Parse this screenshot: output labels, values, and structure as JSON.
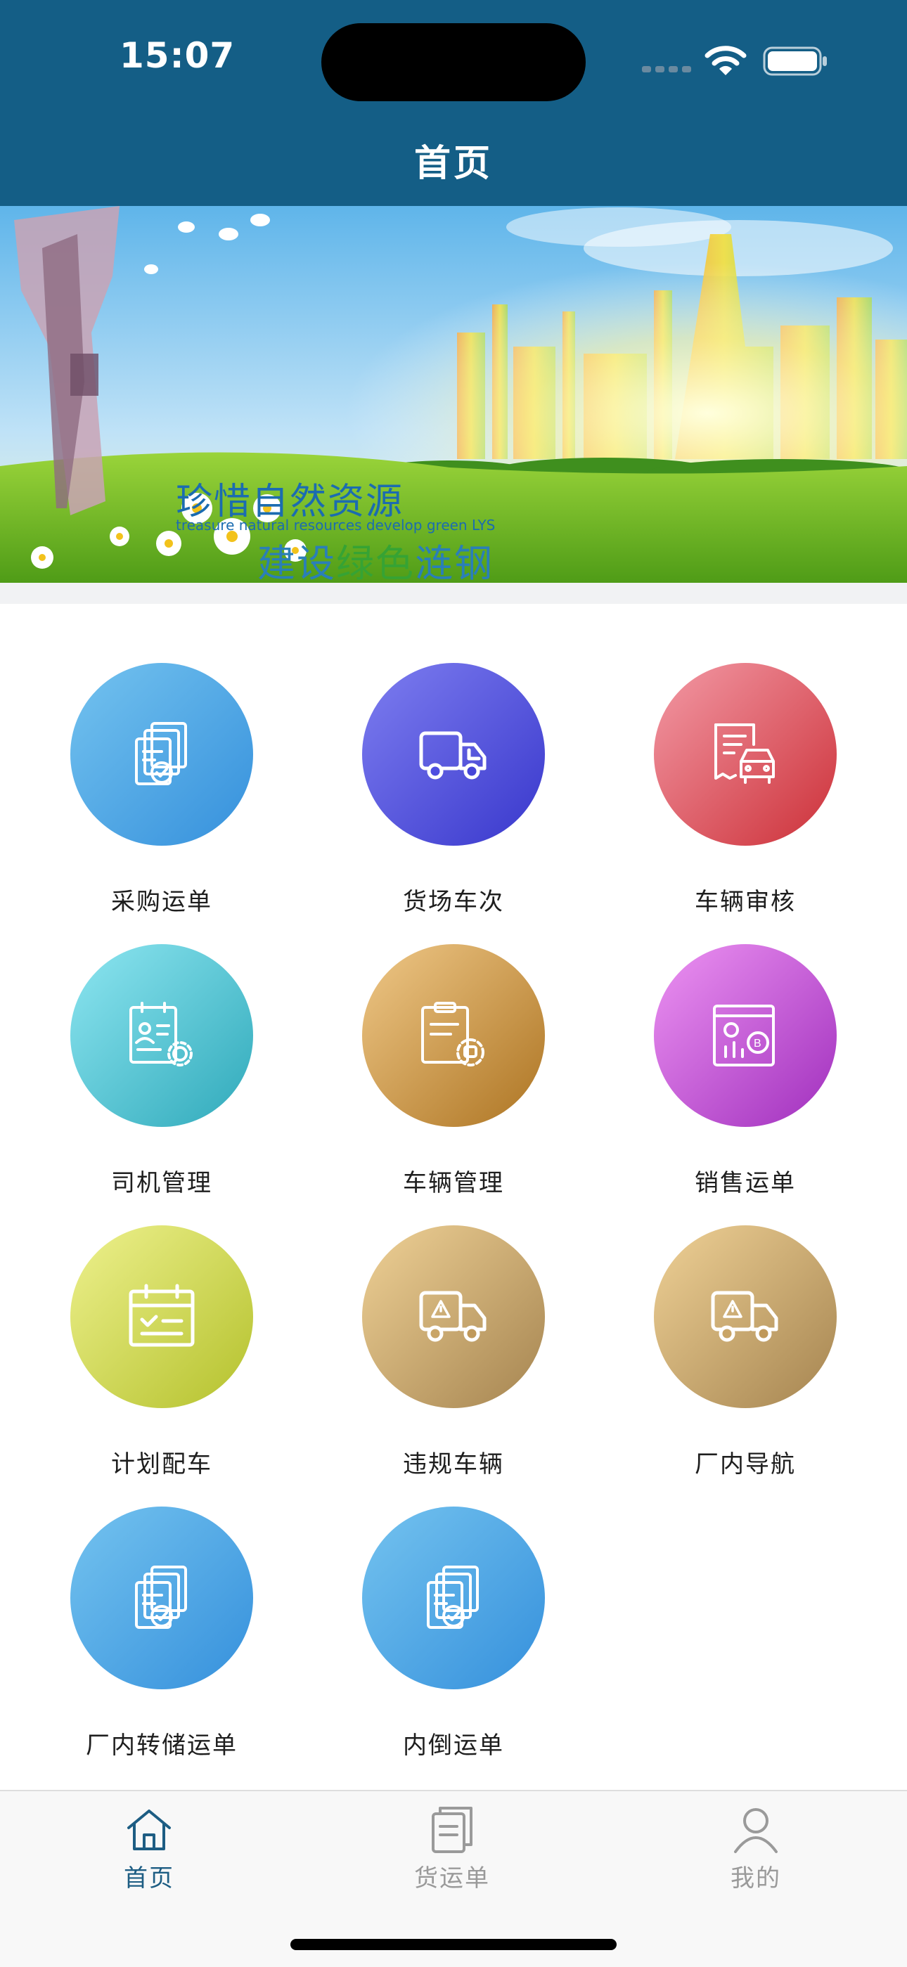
{
  "status_bar": {
    "time": "15:07"
  },
  "header": {
    "title": "首页",
    "background_color": "#145e86"
  },
  "banner": {
    "title": "珍惜自然资源",
    "subtitle": "treasure natural resources develop green LYS",
    "slogan_part1": "建设",
    "slogan_part2": "绿色",
    "slogan_part3": "涟钢"
  },
  "menu": {
    "items": [
      {
        "label": "采购运单",
        "icon": "documents-check-icon",
        "color": "blue"
      },
      {
        "label": "货场车次",
        "icon": "truck-icon",
        "color": "indigo"
      },
      {
        "label": "车辆审核",
        "icon": "document-car-icon",
        "color": "red"
      },
      {
        "label": "司机管理",
        "icon": "clipboard-person-gear-icon",
        "color": "cyan"
      },
      {
        "label": "车辆管理",
        "icon": "clipboard-vehicle-gear-icon",
        "color": "amber"
      },
      {
        "label": "销售运单",
        "icon": "sales-chart-coin-icon",
        "color": "violet"
      },
      {
        "label": "计划配车",
        "icon": "calendar-check-icon",
        "color": "lime"
      },
      {
        "label": "违规车辆",
        "icon": "truck-warning-icon",
        "color": "sand"
      },
      {
        "label": "厂内导航",
        "icon": "truck-warning-icon",
        "color": "sand"
      },
      {
        "label": "厂内转储运单",
        "icon": "documents-check-icon",
        "color": "blue"
      },
      {
        "label": "内倒运单",
        "icon": "documents-check-icon",
        "color": "blue"
      }
    ]
  },
  "tabbar": {
    "tabs": [
      {
        "label": "首页",
        "icon": "home-icon",
        "active": true
      },
      {
        "label": "货运单",
        "icon": "document-list-icon",
        "active": false
      },
      {
        "label": "我的",
        "icon": "person-icon",
        "active": false
      }
    ],
    "active_color": "#1d5d83",
    "inactive_color": "#9a9a9a"
  }
}
